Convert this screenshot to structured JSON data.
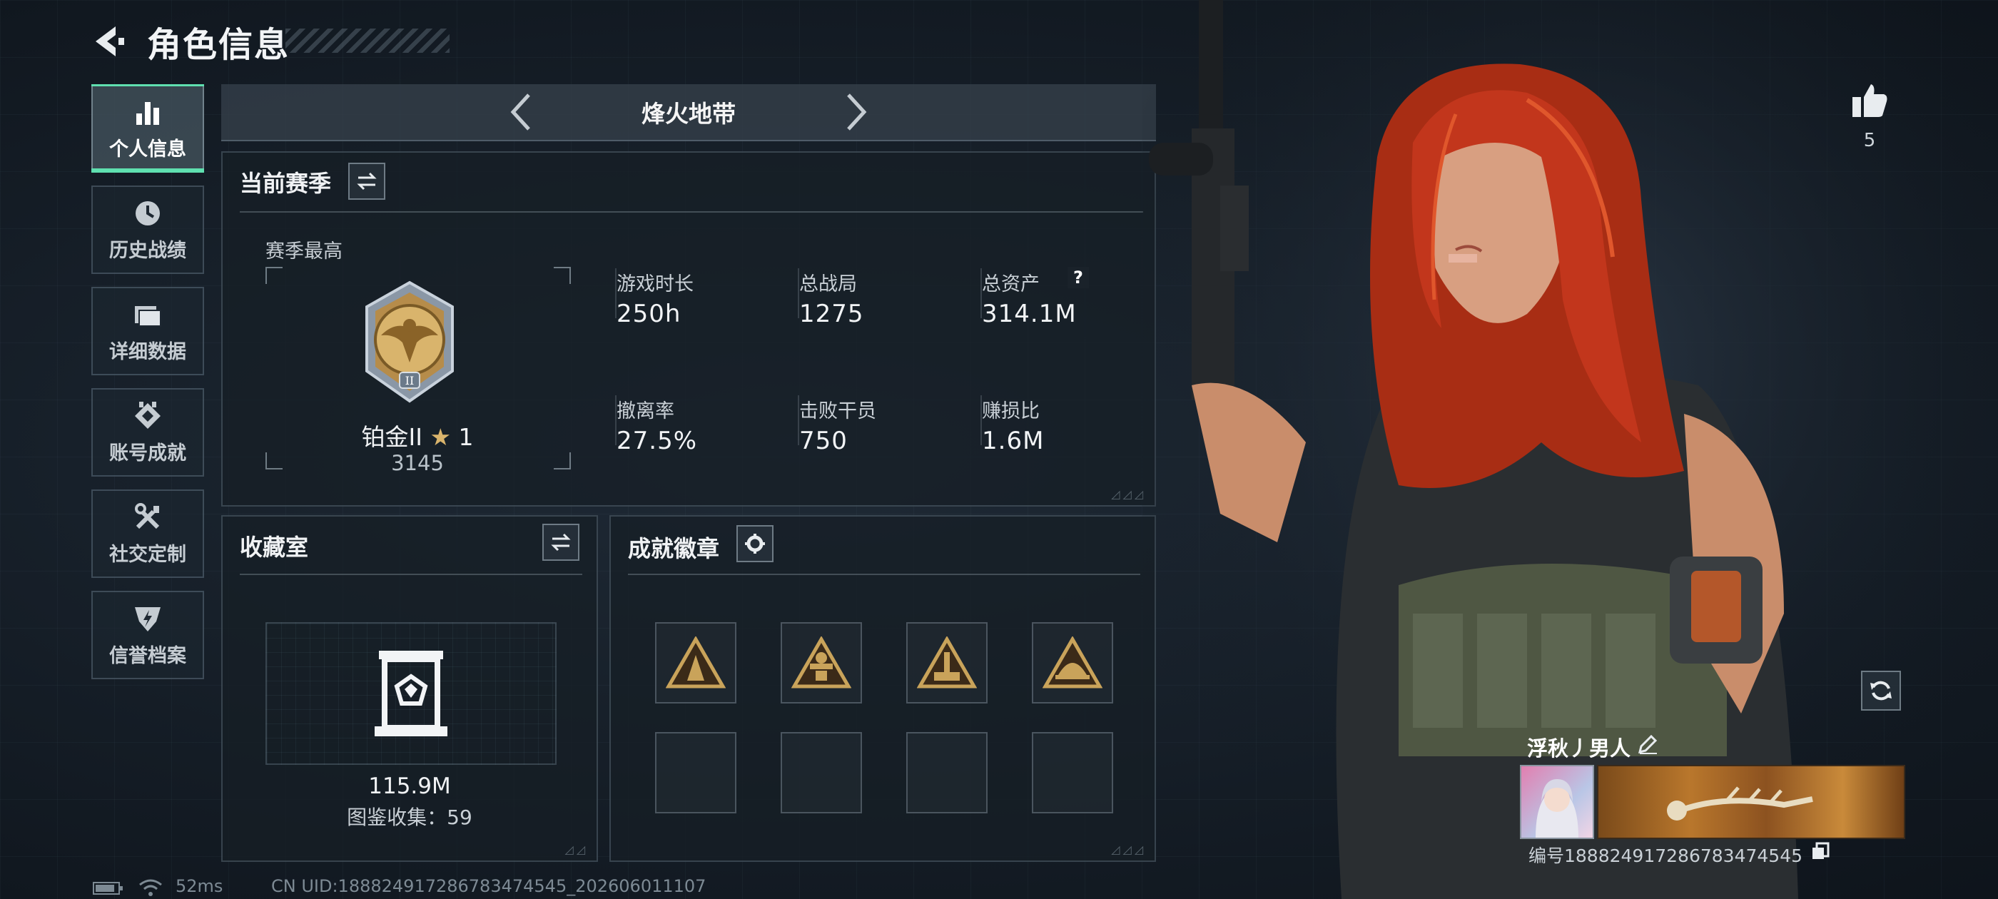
{
  "header": {
    "title": "角色信息"
  },
  "sidebar": {
    "items": [
      {
        "label": "个人信息",
        "icon": "bar-chart-icon",
        "active": true
      },
      {
        "label": "历史战绩",
        "icon": "history-clock-icon"
      },
      {
        "label": "详细数据",
        "icon": "folder-icon"
      },
      {
        "label": "账号成就",
        "icon": "achievement-medal-icon"
      },
      {
        "label": "社交定制",
        "icon": "tools-icon"
      },
      {
        "label": "信誉档案",
        "icon": "shield-icon"
      }
    ]
  },
  "mode": {
    "title": "烽火地带"
  },
  "season": {
    "title": "当前赛季",
    "best_label": "赛季最高",
    "rank_name": "铂金II",
    "rank_stars": "1",
    "rank_score": "3145",
    "stats": [
      {
        "label": "游戏时长",
        "value": "250h"
      },
      {
        "label": "总战局",
        "value": "1275"
      },
      {
        "label": "总资产",
        "value": "314.1M",
        "help": "?"
      },
      {
        "label": "撤离率",
        "value": "27.5%"
      },
      {
        "label": "击败干员",
        "value": "750"
      },
      {
        "label": "赚损比",
        "value": "1.6M"
      }
    ]
  },
  "collection": {
    "title": "收藏室",
    "value": "115.9M",
    "catalog": "图鉴收集：59"
  },
  "achievements": {
    "title": "成就徽章",
    "badges": [
      "badge-1",
      "badge-2",
      "badge-3",
      "badge-4"
    ]
  },
  "profile": {
    "likes": "5",
    "name": "浮秋丿男人",
    "id_text": "编号1888249172867834745​45"
  },
  "footer": {
    "ping": "52ms",
    "uid": "CN UID:18882491728678347454​5_202606011107"
  },
  "colors": {
    "accent": "#5fe0b0",
    "hair": "#c2361c",
    "gold": "#c9a35a"
  }
}
